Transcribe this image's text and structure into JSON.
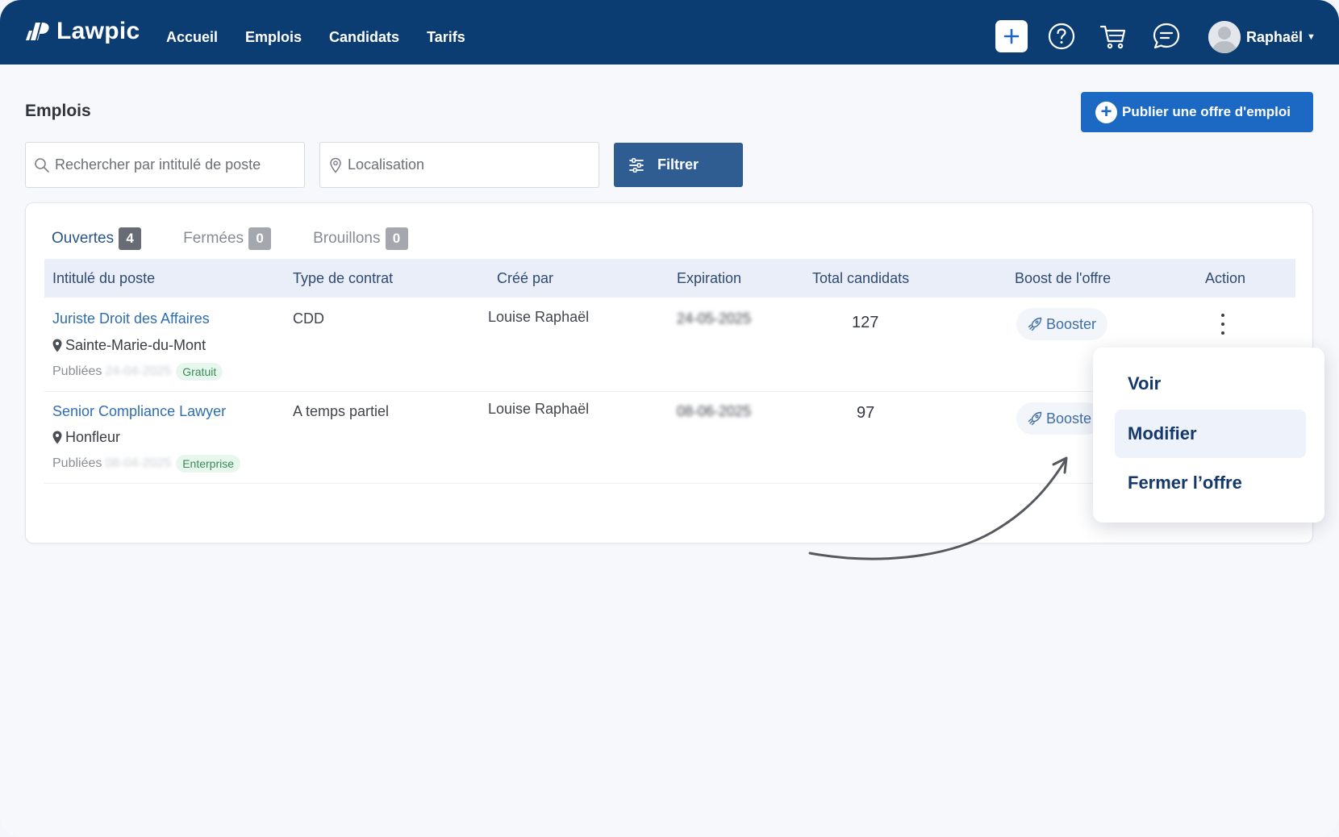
{
  "brand": {
    "name": "Lawpic"
  },
  "nav": [
    "Accueil",
    "Emplois",
    "Candidats",
    "Tarifs"
  ],
  "header_icons": [
    "plus-icon",
    "help-icon",
    "cart-icon",
    "chat-icon"
  ],
  "user": {
    "name": "Raphaël"
  },
  "page": {
    "title": "Emplois",
    "publish_label": "Publier une offre d'emploi"
  },
  "search": {
    "title_placeholder": "Rechercher par intitulé de poste",
    "location_placeholder": "Localisation",
    "filter_label": "Filtrer"
  },
  "tabs": [
    {
      "label": "Ouvertes",
      "count": "4"
    },
    {
      "label": "Fermées",
      "count": "0"
    },
    {
      "label": "Brouillons",
      "count": "0"
    }
  ],
  "table": {
    "headers": [
      "Intitulé du poste",
      "Type de contrat",
      "Créé par",
      "Expiration",
      "Total candidats",
      "Boost de l'offre",
      "Action"
    ],
    "rows": [
      {
        "title": "Juriste Droit des Affaires",
        "location": "Sainte-Marie-du-Mont",
        "published_label": "Publiées",
        "published_date": "24-04-2025",
        "plan": "Gratuit",
        "contract": "CDD",
        "created_by": "Louise Raphaël",
        "expiration": "24-05-2025",
        "candidates": "127",
        "boost_label": "Booster"
      },
      {
        "title": "Senior Compliance Lawyer",
        "location": "Honfleur",
        "published_label": "Publiées",
        "published_date": "08-04-2025",
        "plan": "Enterprise",
        "contract": "A temps partiel",
        "created_by": "Louise Raphaël",
        "expiration": "08-06-2025",
        "candidates": "97",
        "boost_label": "Booste"
      }
    ]
  },
  "action_menu": {
    "items": [
      "Voir",
      "Modifier",
      "Fermer l’offre"
    ],
    "highlighted": "Modifier"
  },
  "colors": {
    "topbar": "#0c3d72",
    "primary": "#1c69c4",
    "filter": "#2f5d92",
    "link": "#2f6db3"
  }
}
